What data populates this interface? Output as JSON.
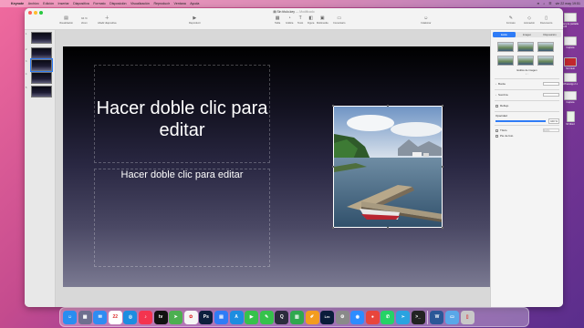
{
  "menubar": {
    "items": [
      "Keynote",
      "Archivo",
      "Edición",
      "Insertar",
      "Diapositiva",
      "Formato",
      "Disposición",
      "Visualización",
      "Reproducir",
      "Ventana",
      "Ayuda"
    ],
    "clock": "vie 22 may 19:51"
  },
  "window": {
    "title": "Sin título.key",
    "subtitle": "— Modificado",
    "toolbar": {
      "view": "Visualización",
      "zoom": "Zoom",
      "zoom_value": "94 %",
      "add_slide": "Añadir diapositiva",
      "play": "Reproducir",
      "table": "Tabla",
      "chart": "Gráfica",
      "text": "Texto",
      "shape": "Figura",
      "media": "Multimedia",
      "comment": "Comentario",
      "collaborate": "Colaborar",
      "format": "Formato",
      "animate": "Animación",
      "document": "Documento"
    }
  },
  "navigator": {
    "slides": [
      "1",
      "2",
      "3",
      "4",
      "5"
    ],
    "selected": 2
  },
  "slide": {
    "title": "Hacer doble clic para editar",
    "body": "Hacer doble clic para editar"
  },
  "inspector": {
    "tabs": [
      "Estilo",
      "Imagen",
      "Disposición"
    ],
    "active_tab": "Estilo",
    "styles_label": "Estilos de imagen",
    "border_label": "Borde",
    "shadow_label": "Sombra",
    "reflection_label": "Reflejo",
    "opacity_label": "Opacidad",
    "opacity_value": "100 %",
    "opacity_level": 1.0,
    "title_label": "Título",
    "title_placeholder": "Estilo",
    "caption_label": "Pie de foto"
  },
  "desktop": {
    "items": [
      "Captura de pantalla 2020-05",
      "Captura",
      "Sin título",
      "WhatsApp 2.1",
      "Captura",
      "Mi Word"
    ]
  },
  "dock": {
    "apps": [
      {
        "name": "finder-icon",
        "color": "#2a8df0",
        "glyph": "☺"
      },
      {
        "name": "launchpad-icon",
        "color": "#6f6f8f",
        "glyph": "▦"
      },
      {
        "name": "mail-icon",
        "color": "#2f8cf2",
        "glyph": "✉"
      },
      {
        "name": "calendar-icon",
        "color": "#ffffff",
        "glyph": "22"
      },
      {
        "name": "safari-icon",
        "color": "#1d8de0",
        "glyph": "◎"
      },
      {
        "name": "music-icon",
        "color": "#f4344f",
        "glyph": "♪"
      },
      {
        "name": "appletv-icon",
        "color": "#111111",
        "glyph": "tv"
      },
      {
        "name": "maps-icon",
        "color": "#4caf50",
        "glyph": "➤"
      },
      {
        "name": "photos-icon",
        "color": "#f5f5f5",
        "glyph": "✿"
      },
      {
        "name": "photoshop-icon",
        "color": "#0c1f3d",
        "glyph": "Ps"
      },
      {
        "name": "keynote-icon",
        "color": "#2f7cf6",
        "glyph": "▤"
      },
      {
        "name": "appstore-icon",
        "color": "#1d8de0",
        "glyph": "A"
      },
      {
        "name": "facetime-icon",
        "color": "#36c24b",
        "glyph": "▶"
      },
      {
        "name": "messages-icon",
        "color": "#36c24b",
        "glyph": "✎"
      },
      {
        "name": "quicktime-icon",
        "color": "#2b2b3d",
        "glyph": "Q"
      },
      {
        "name": "numbers-icon",
        "color": "#2fa84f",
        "glyph": "▥"
      },
      {
        "name": "pages-icon",
        "color": "#f39c1f",
        "glyph": "✐"
      },
      {
        "name": "lightroom-icon",
        "color": "#0a1c3a",
        "glyph": "Lrc"
      },
      {
        "name": "settings-icon",
        "color": "#8a8a8a",
        "glyph": "⚙"
      },
      {
        "name": "zoom-icon",
        "color": "#2d8cff",
        "glyph": "◉"
      },
      {
        "name": "chrome-icon",
        "color": "#e8453c",
        "glyph": "●"
      },
      {
        "name": "whatsapp-icon",
        "color": "#25d366",
        "glyph": "✆"
      },
      {
        "name": "telegram-icon",
        "color": "#2aa3e0",
        "glyph": "➢"
      },
      {
        "name": "terminal-icon",
        "color": "#222222",
        "glyph": ">_"
      },
      {
        "name": "word-icon",
        "color": "#2b5797",
        "glyph": "W"
      },
      {
        "name": "folder-icon",
        "color": "#5aa7e8",
        "glyph": "▭"
      },
      {
        "name": "trash-icon",
        "color": "#c8c8c8",
        "glyph": "▯"
      }
    ]
  }
}
